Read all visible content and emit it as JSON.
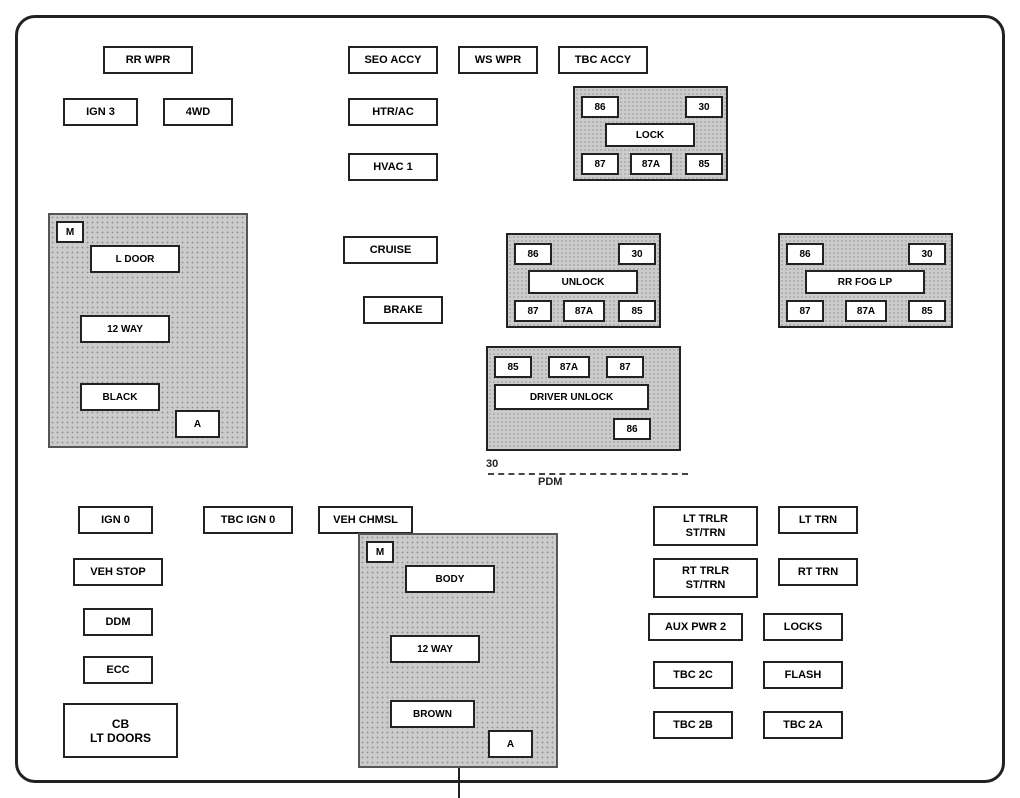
{
  "components": {
    "top_row": {
      "rr_wpr": "RR WPR",
      "seo_accy": "SEO ACCY",
      "ws_wpr": "WS WPR",
      "tbc_accy": "TBC ACCY"
    },
    "second_row": {
      "ign3": "IGN 3",
      "fwd": "4WD",
      "htr_ac": "HTR/AC"
    },
    "third_row": {
      "hvac1": "HVAC 1"
    },
    "relay_lock": {
      "r86": "86",
      "r30": "30",
      "label": "LOCK",
      "r87": "87",
      "r87a": "87A",
      "r85": "85"
    },
    "relay_unlock": {
      "r86": "86",
      "r30": "30",
      "label": "UNLOCK",
      "r87": "87",
      "r87a": "87A",
      "r85": "85"
    },
    "relay_rr_fog": {
      "r86": "86",
      "r30": "30",
      "label": "RR FOG LP",
      "r87": "87",
      "r87a": "87A",
      "r85": "85"
    },
    "relay_driver_unlock": {
      "r85": "85",
      "r87a": "87A",
      "r87": "87",
      "label": "DRIVER UNLOCK",
      "r86": "86",
      "r30": "30"
    },
    "cruise": "CRUISE",
    "brake": "BRAKE",
    "ldoor_group": {
      "m": "M",
      "ldoor": "L DOOR",
      "way12": "12 WAY",
      "black": "BLACK",
      "a": "A"
    },
    "body_group": {
      "m": "M",
      "body": "BODY",
      "way12": "12 WAY",
      "brown": "BROWN",
      "a": "A"
    },
    "pdm": "PDM",
    "bottom_left": {
      "ign0": "IGN 0",
      "tbc_ign0": "TBC IGN 0",
      "veh_chmsl": "VEH CHMSL",
      "veh_stop": "VEH STOP",
      "ddm": "DDM",
      "ecc": "ECC",
      "cb_lt_doors": "CB\nLT DOORS"
    },
    "bottom_right": {
      "lt_trlr_sttrn": "LT TRLR\nST/TRN",
      "lt_trn": "LT TRN",
      "rt_trlr_sttrn": "RT TRLR\nST/TRN",
      "rt_trn": "RT TRN",
      "aux_pwr2": "AUX PWR 2",
      "locks": "LOCKS",
      "tbc_2c": "TBC 2C",
      "flash": "FLASH",
      "tbc_2b": "TBC 2B",
      "tbc_2a": "TBC 2A"
    }
  }
}
